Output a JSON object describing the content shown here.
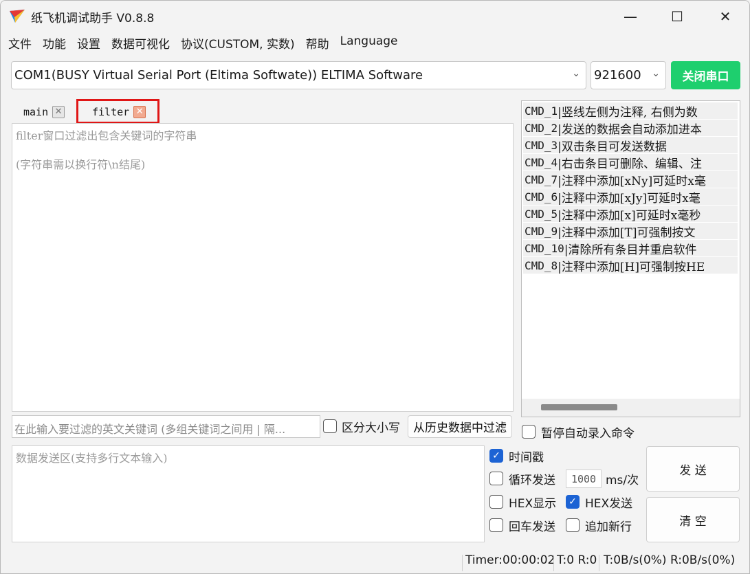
{
  "window": {
    "title": "纸飞机调试助手 V0.8.8",
    "minimize": "—",
    "maximize": "☐",
    "close": "✕"
  },
  "menu": [
    "文件",
    "功能",
    "设置",
    "数据可视化",
    "协议(CUSTOM, 实数)",
    "帮助",
    "Language"
  ],
  "port": {
    "selected": "COM1(BUSY  Virtual Serial Port (Eltima Softwate)) ELTIMA Software",
    "baud": "921600",
    "close_port_button": "关闭串口"
  },
  "tabs": [
    {
      "label": "main",
      "active": false
    },
    {
      "label": "filter",
      "active": true
    }
  ],
  "filter_panel": {
    "hint_line1": "filter窗口过滤出包含关键词的字符串",
    "hint_line2": "(字符串需以换行符\\n结尾)",
    "keyword_placeholder": "在此输入要过滤的英文关键词 (多组关键词之间用 | 隔...",
    "case_sensitive_label": "区分大小写",
    "case_sensitive": false,
    "filter_history_button": "从历史数据中过滤"
  },
  "commands": [
    {
      "name": "CMD_1 ",
      "text": "|竖线左侧为注释, 右侧为数"
    },
    {
      "name": "CMD_2 ",
      "text": "|发送的数据会自动添加进本"
    },
    {
      "name": "CMD_3 ",
      "text": "|双击条目可发送数据"
    },
    {
      "name": "CMD_4 ",
      "text": "|右击条目可删除、编辑、注"
    },
    {
      "name": "CMD_7 ",
      "text": "|注释中添加[xNy]可延时x毫"
    },
    {
      "name": "CMD_6 ",
      "text": "|注释中添加[xJy]可延时x毫"
    },
    {
      "name": "CMD_5 ",
      "text": "|注释中添加[x]可延时x毫秒"
    },
    {
      "name": "CMD_9 ",
      "text": "|注释中添加[T]可强制按文"
    },
    {
      "name": "CMD_10 ",
      "text": "|清除所有条目并重启软件"
    },
    {
      "name": "CMD_8 ",
      "text": "|注释中添加[H]可强制按HE"
    }
  ],
  "pause_record_label": "暂停自动录入命令",
  "send_area_placeholder": "数据发送区(支持多行文本输入)",
  "options": {
    "timestamp_label": "时间戳",
    "timestamp": true,
    "loop_send_label": "循环发送",
    "loop_send": false,
    "loop_interval": "1000",
    "loop_unit": "ms/次",
    "hex_display_label": "HEX显示",
    "hex_display": false,
    "hex_send_label": "HEX发送",
    "hex_send": true,
    "enter_send_label": "回车发送",
    "enter_send": false,
    "append_newline_label": "追加新行",
    "append_newline": false
  },
  "send_button": "发 送",
  "clear_button": "清 空",
  "statusbar": {
    "timer": "Timer:00:00:02",
    "tr": "T:0 R:0",
    "rate": "T:0B/s(0%) R:0B/s(0%)"
  },
  "colors": {
    "accent_green": "#1ecf6e",
    "highlight_red": "#e01616",
    "checkbox_blue": "#1c63d4"
  }
}
